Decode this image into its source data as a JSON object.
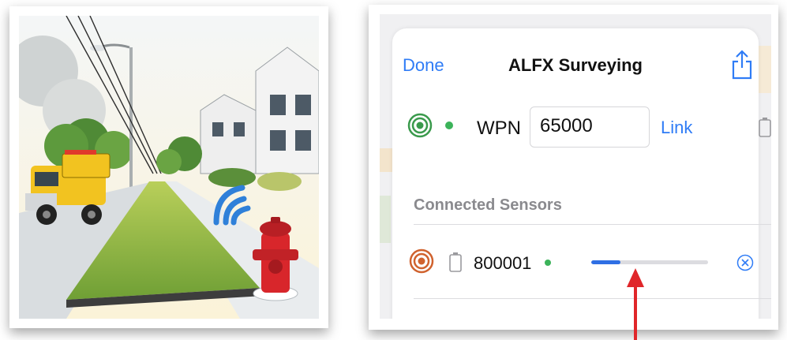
{
  "illustration": {
    "description_icon": "street-hydrant-wireless-illustration",
    "sky_color": "#eef2f5",
    "grass_color": "#7fae3a",
    "truck_color": "#f2c320",
    "hydrant_color": "#d8262b",
    "signal_color": "#2f80d9"
  },
  "app": {
    "done_label": "Done",
    "title": "ALFX Surveying",
    "share_icon": "share-icon",
    "accent_color": "#2f7cf6"
  },
  "wpn_row": {
    "status_icon": "radio-target-icon",
    "status_icon_color": "#3a9a4c",
    "status_dot_color": "#3cb35a",
    "label": "WPN",
    "value": "65000",
    "link_label": "Link",
    "battery_icon": "battery-icon"
  },
  "sensors": {
    "header": "Connected Sensors",
    "items": [
      {
        "status_icon": "radio-target-icon",
        "status_icon_color": "#d0622e",
        "battery_icon": "battery-icon",
        "id": "800001",
        "status_dot_color": "#3cb35a",
        "progress": 0.25,
        "remove_icon": "remove-x-icon"
      }
    ]
  },
  "annotation": {
    "arrow_color": "#e0262a",
    "arrow_icon": "up-arrow-icon"
  }
}
